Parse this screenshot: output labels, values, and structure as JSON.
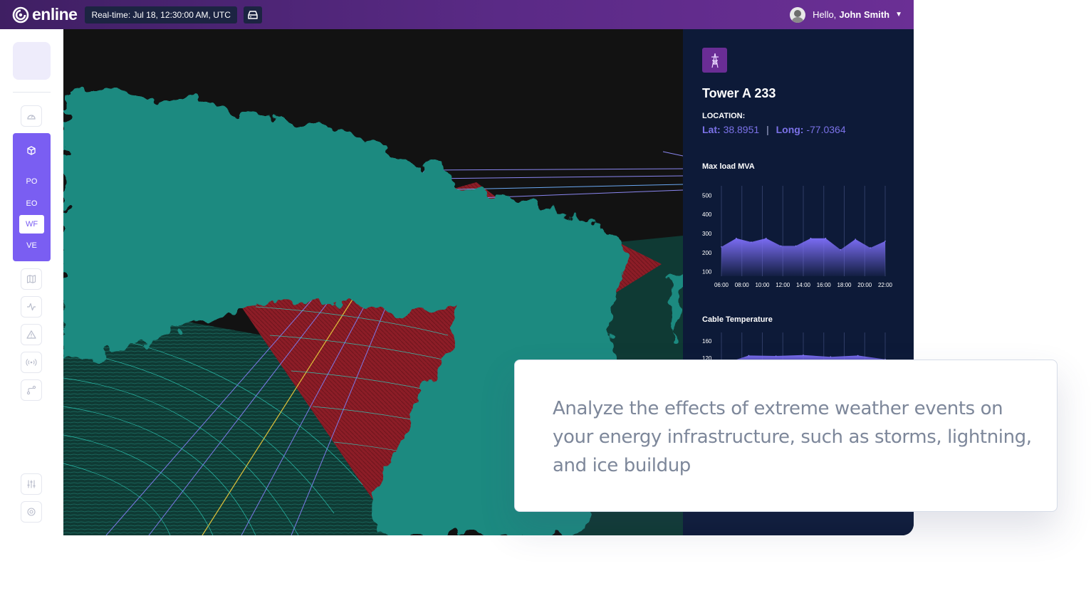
{
  "topbar": {
    "brand": "enline",
    "realtime": "Real-time: Jul 18, 12:30:00 AM, UTC",
    "greeting": "Hello,",
    "user_name": "John Smith"
  },
  "sidebar": {
    "active_group_items": [
      {
        "label": "PO",
        "selected": false
      },
      {
        "label": "EO",
        "selected": false
      },
      {
        "label": "WF",
        "selected": true
      },
      {
        "label": "VE",
        "selected": false
      }
    ],
    "icons": [
      "gauge-icon",
      "cube-icon",
      "map-icon",
      "activity-icon",
      "warning-icon",
      "broadcast-icon",
      "route-icon",
      "sliders-icon",
      "settings-icon"
    ]
  },
  "panel": {
    "title": "Tower A 233",
    "location_label": "LOCATION:",
    "lat_label": "Lat:",
    "lat_value": "38.8951",
    "long_label": "Long:",
    "long_value": "-77.0364"
  },
  "chart_data": [
    {
      "type": "area",
      "title": "Max load MVA",
      "x": [
        "06:00",
        "08:00",
        "10:00",
        "12:00",
        "14:00",
        "16:00",
        "18:00",
        "20:00",
        "22:00"
      ],
      "values": [
        230,
        275,
        255,
        275,
        235,
        235,
        275,
        275,
        215,
        270,
        225,
        260
      ],
      "y_ticks": [
        100,
        200,
        300,
        400,
        500
      ],
      "ylim": [
        50,
        550
      ]
    },
    {
      "type": "area",
      "title": "Cable Temperature",
      "y_ticks": [
        120,
        160
      ],
      "values": [
        105,
        126,
        125,
        127,
        123,
        126,
        117
      ],
      "ylim": [
        80,
        180
      ]
    }
  ],
  "colors": {
    "brand_purple": "#5a2a86",
    "accent": "#7a5ef2",
    "panel_bg": "#0d1a38",
    "vegetation": "#1b8a80",
    "risk_zone": "#8a1d26"
  },
  "callout": {
    "text": "Analyze the effects of extreme weather events on your energy infrastructure, such as storms, lightning, and ice buildup"
  }
}
